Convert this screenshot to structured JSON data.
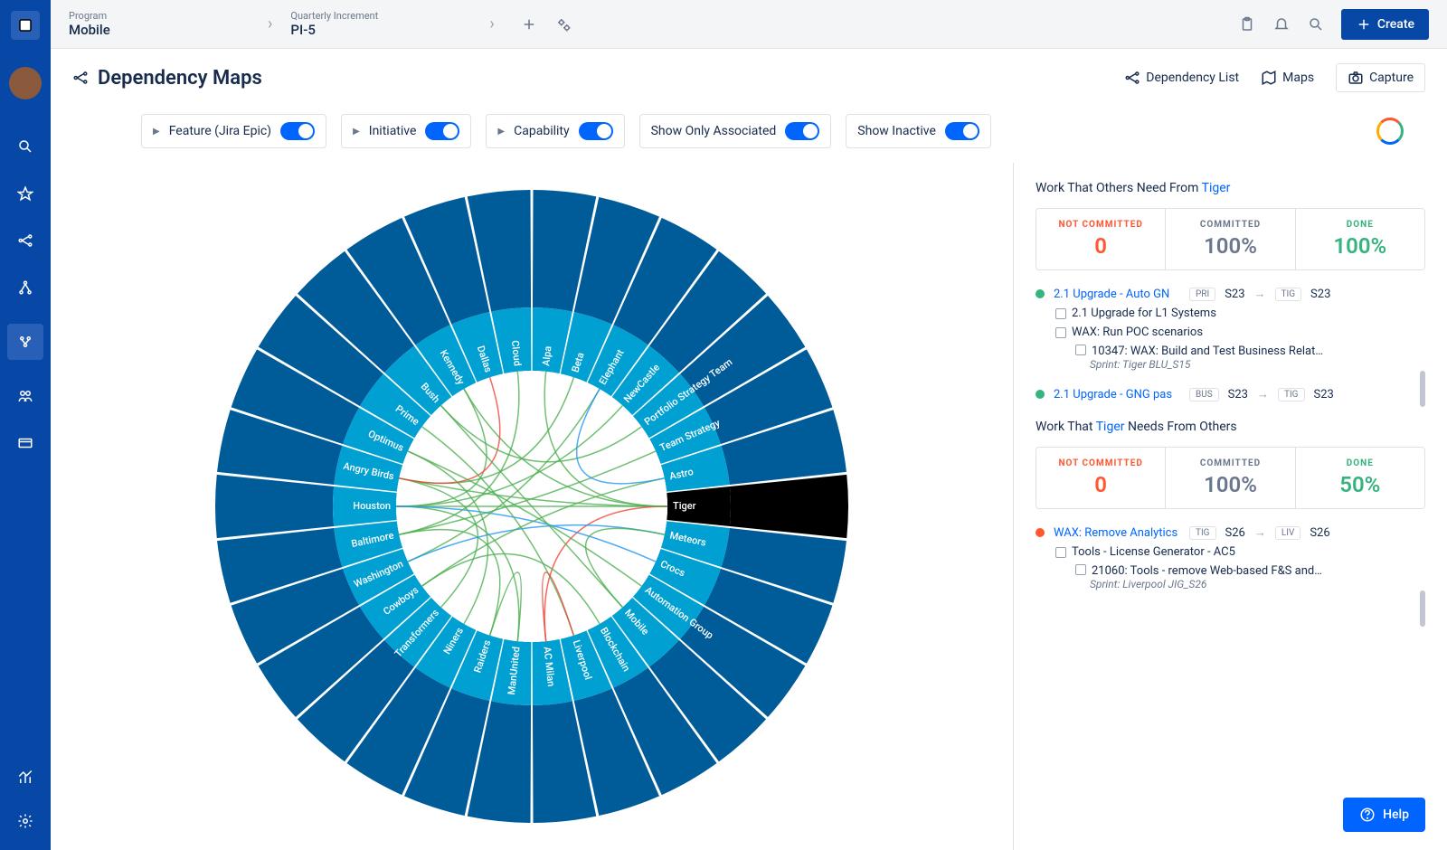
{
  "breadcrumb": {
    "program_label": "Program",
    "program_value": "Mobile",
    "qi_label": "Quarterly Increment",
    "qi_value": "PI-5"
  },
  "create_label": "Create",
  "page_title": "Dependency Maps",
  "header_links": {
    "dep_list": "Dependency List",
    "maps": "Maps",
    "capture": "Capture"
  },
  "filters": {
    "feature": "Feature (Jira Epic)",
    "initiative": "Initiative",
    "capability": "Capability",
    "show_assoc": "Show Only Associated",
    "show_inactive": "Show Inactive"
  },
  "chart_data": {
    "type": "chord",
    "selected": "Tiger",
    "segments": [
      "Alpa",
      "Beta",
      "Elephant",
      "NewCastle",
      "Portfolio Strategy Team",
      "Team Strategy",
      "Astro",
      "Tiger",
      "Meteors",
      "Crocs",
      "Automation Group",
      "Mobile",
      "Blockchain",
      "Liverpool",
      "AC Milan",
      "ManUnited",
      "Raiders",
      "Niners",
      "Transformers",
      "Cowboys",
      "Washington",
      "Baltimore",
      "Houston",
      "Angry Birds",
      "Optimus",
      "Prime",
      "Bush",
      "Kennedy",
      "Dallas",
      "Cloud"
    ],
    "spoke_color": "#005B99",
    "wedge_color": "#00A0D2",
    "selected_color": "#000000",
    "chord_colors": [
      "#4CAF50",
      "#F44336",
      "#2196F3"
    ]
  },
  "panel": {
    "heading1_pre": "Work That Others Need From ",
    "heading1_link": "Tiger",
    "heading2_pre": "Work That ",
    "heading2_link": "Tiger",
    "heading2_post": "  Needs From Others",
    "stats1": {
      "nc_label": "NOT COMMITTED",
      "nc_value": "0",
      "com_label": "COMMITTED",
      "com_value": "100%",
      "done_label": "DONE",
      "done_value": "100%"
    },
    "stats2": {
      "nc_label": "NOT COMMITTED",
      "nc_value": "0",
      "com_label": "COMMITTED",
      "com_value": "100%",
      "done_label": "DONE",
      "done_value": "50%"
    },
    "items1": [
      {
        "dot": "green",
        "title": "2.1 Upgrade - Auto GN",
        "tag1": "PRI",
        "s1": "S23",
        "tag2": "TIG",
        "s2": "S23",
        "subs": [
          {
            "text": "2.1 Upgrade for L1 Systems"
          },
          {
            "text": "WAX: Run POC scenarios",
            "children": [
              {
                "text": "10347: WAX: Build and Test Business Relat…",
                "sprint": "Sprint: Tiger BLU_S15"
              }
            ]
          }
        ]
      },
      {
        "dot": "green",
        "title": "2.1 Upgrade - GNG pas",
        "tag1": "BUS",
        "s1": "S23",
        "tag2": "TIG",
        "s2": "S23",
        "subs": []
      }
    ],
    "items2": [
      {
        "dot": "red",
        "title": "WAX: Remove Analytics",
        "tag1": "TIG",
        "s1": "S26",
        "tag2": "LIV",
        "s2": "S26",
        "subs": [
          {
            "text": "Tools - License Generator - AC5",
            "children": [
              {
                "text": "21060: Tools - remove Web-based F&S and…",
                "sprint": "Sprint: Liverpool JIG_S26"
              }
            ]
          }
        ]
      }
    ]
  },
  "help_label": "Help"
}
